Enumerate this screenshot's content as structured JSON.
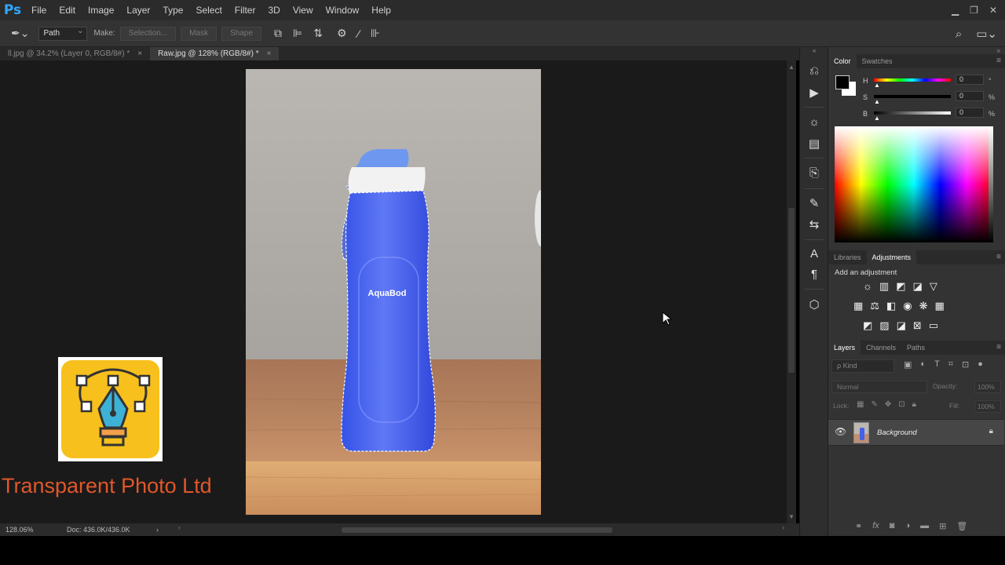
{
  "app": {
    "logo": "Ps"
  },
  "menu": [
    "File",
    "Edit",
    "Image",
    "Layer",
    "Type",
    "Select",
    "Filter",
    "3D",
    "View",
    "Window",
    "Help"
  ],
  "window_controls": [
    "minimize-icon",
    "restore-icon",
    "close-icon"
  ],
  "options": {
    "mode_value": "Path",
    "make_label": "Make:",
    "selection_label": "Selection...",
    "mask_label": "Mask",
    "shape_label": "Shape"
  },
  "tabs": [
    {
      "label": "ll.jpg @ 34.2% (Layer 0, RGB/8#) *",
      "active": false
    },
    {
      "label": "Raw.jpg @ 128% (RGB/8#) *",
      "active": true
    }
  ],
  "canvas": {
    "bottle_brand": "AquaBod",
    "watermark_text": "Transparent Photo Ltd",
    "brand_color": "#e1572a"
  },
  "status": {
    "zoom": "128.06%",
    "doc": "Doc: 436.0K/436.0K"
  },
  "color_panel": {
    "tabs": [
      "Color",
      "Swatches"
    ],
    "sliders": [
      {
        "label": "H",
        "value": "0",
        "unit": "°"
      },
      {
        "label": "S",
        "value": "0",
        "unit": "%"
      },
      {
        "label": "B",
        "value": "0",
        "unit": "%"
      }
    ]
  },
  "adjustments_panel": {
    "tabs": [
      "Libraries",
      "Adjustments"
    ],
    "title": "Add an adjustment"
  },
  "layers_panel": {
    "tabs": [
      "Layers",
      "Channels",
      "Paths"
    ],
    "search_placeholder": "ρ Kind",
    "blend_mode": "Normal",
    "opacity_label": "Opacity:",
    "opacity_value": "100%",
    "lock_label": "Lock:",
    "fill_label": "Fill:",
    "fill_value": "100%",
    "layers": [
      {
        "name": "Background",
        "locked": true,
        "visible": true
      }
    ]
  }
}
